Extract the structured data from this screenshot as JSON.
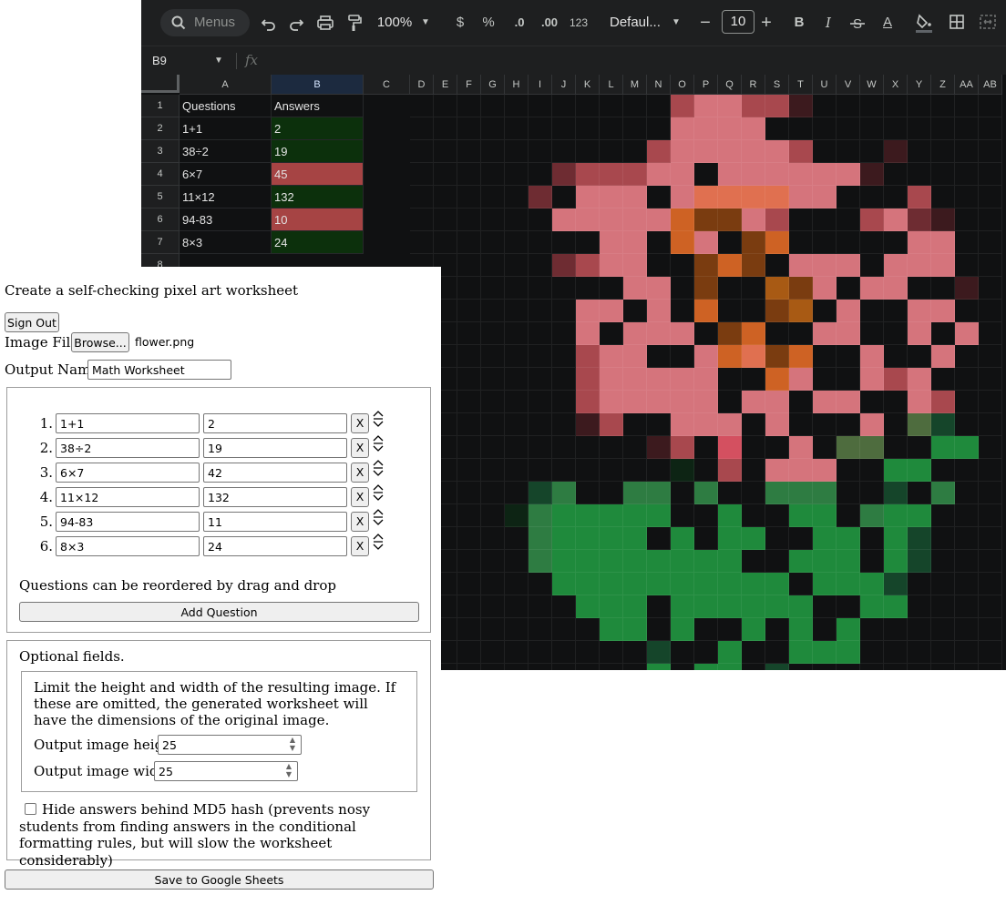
{
  "sheets": {
    "toolbar": {
      "search_placeholder": "Menus",
      "zoom": "100%",
      "currency": "$",
      "percent": "%",
      "decrease_decimal": ".0",
      "increase_decimal": ".00",
      "format_number": "123",
      "font": "Defaul...",
      "font_size": "10",
      "bold": "B",
      "italic": "I",
      "text_color": "A"
    },
    "name_box": "B9",
    "columns": [
      "A",
      "B",
      "C",
      "D",
      "E",
      "F",
      "G",
      "H",
      "I",
      "J",
      "K",
      "L",
      "M",
      "N",
      "O",
      "P",
      "Q",
      "R",
      "S",
      "T",
      "U",
      "V",
      "W",
      "X",
      "Y",
      "Z",
      "AA",
      "AB"
    ],
    "rows": [
      "1",
      "2",
      "3",
      "4",
      "5",
      "6",
      "7",
      "8"
    ],
    "headers": {
      "a": "Questions",
      "b": "Answers"
    },
    "data_rows": [
      {
        "q": "1+1",
        "a": "2",
        "status": "correct"
      },
      {
        "q": "38÷2",
        "a": "19",
        "status": "correct"
      },
      {
        "q": "6×7",
        "a": "45",
        "status": "wrong"
      },
      {
        "q": "11×12",
        "a": "132",
        "status": "correct"
      },
      {
        "q": "94-83",
        "a": "10",
        "status": "wrong"
      },
      {
        "q": "8×3",
        "a": "24",
        "status": "correct"
      }
    ],
    "status_colors": {
      "correct": "#0c300c",
      "wrong": "#a64444"
    },
    "pixel_palette": {
      ".": "#101112",
      "p": "#d5747c",
      "m": "#a8484e",
      "d": "#6e2c32",
      "x": "#3c1a1e",
      "o": "#ce6224",
      "b": "#7a3c10",
      "n": "#a85a14",
      "g": "#1f8a3c",
      "h": "#2e7c42",
      "k": "#15452a",
      "e": "#0d2414",
      "l": "#4e6c3e",
      "r": "#d45060",
      "c": "#e07050"
    },
    "pixel_rows": [
      "...........mppmmx........",
      "...........pppp..........",
      "..........mpppppm...x....",
      "......dmmmpp.ppppppx.....",
      ".....d.ppp.pccccpp...m...",
      "......pppppobbpm...mpdx..",
      "........pp.op.bo.....pp..",
      "......dmpp..bob.ppp.ppp..",
      ".........pp.b..nbp.pp..x.",
      ".......pp.p.o..bn.p..pp..",
      ".......p.ppp.bo..pp..p.p.",
      ".......mpp..pocbo..p..p..",
      ".......mppppp..op..pmp...",
      ".......mppppp.pp.pp..pm..",
      ".......xm..ppp.p...p.lk..",
      "..........xm.r..p.ll..gg.",
      "...........e.m.ppp..gg...",
      ".....kh..hh.h..hhh..k.h..",
      "....ehggggg..g..gg.hgg...",
      ".....hgggg.g.gg..gg.gk...",
      ".....hgggggggg..ggg.gk...",
      "......gggggggggg.gggk....",
      ".......ggg.gggggg..gg....",
      "........gg.g..g.g.g......",
      "..........k..g..ggg......",
      "..........g.gg.k.........",
      ".........h..ggg..........",
      ".........e...g...........",
      ".........k.gg.g..........",
      "............g..gg........"
    ]
  },
  "form": {
    "title": "Create a self-checking pixel art worksheet",
    "sign_out": "Sign Out",
    "image_file_label": "Image File",
    "browse": "Browse...",
    "file_name": "flower.png",
    "output_name_label": "Output Name",
    "output_name_value": "Math Worksheet",
    "questions": [
      {
        "n": "1.",
        "q": "1+1",
        "a": "2"
      },
      {
        "n": "2.",
        "q": "38÷2",
        "a": "19"
      },
      {
        "n": "3.",
        "q": "6×7",
        "a": "42"
      },
      {
        "n": "4.",
        "q": "11×12",
        "a": "132"
      },
      {
        "n": "5.",
        "q": "94-83",
        "a": "11"
      },
      {
        "n": "6.",
        "q": "8×3",
        "a": "24"
      }
    ],
    "remove_label": "X",
    "reorder_note": "Questions can be reordered by drag and drop",
    "add_question": "Add Question",
    "optional_label": "Optional fields.",
    "limit_note": "Limit the height and width of the resulting image. If these are omitted, the generated worksheet will have the dimensions of the original image.",
    "height_label": "Output image height",
    "height_value": "25",
    "width_label": "Output image width",
    "width_value": "25",
    "hash_label": "Hide answers behind MD5 hash (prevents nosy students from finding answers in the conditional formatting rules, but will slow the worksheet considerably)",
    "hash_checked": false,
    "save": "Save to Google Sheets"
  }
}
